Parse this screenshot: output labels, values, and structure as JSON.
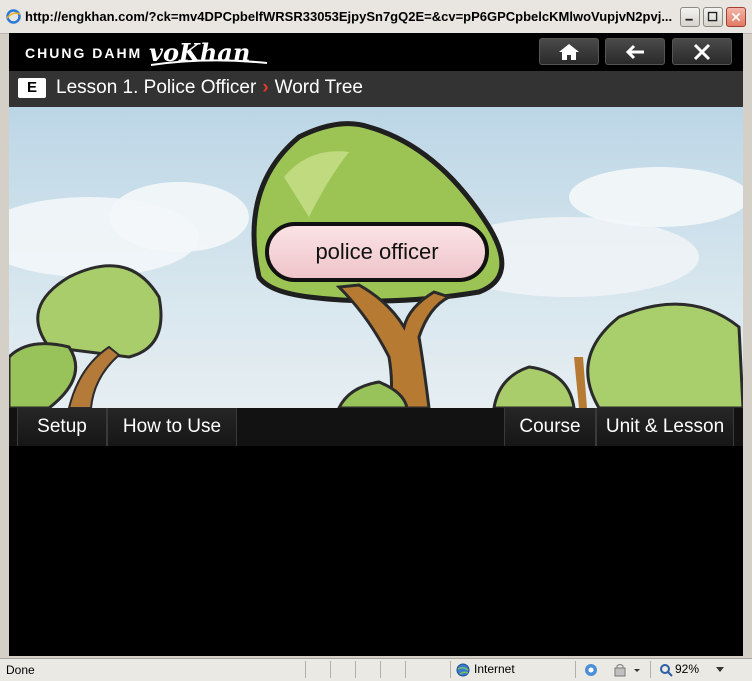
{
  "browser": {
    "title": "http://engkhan.com/?ck=mv4DPCpbelfWRSR33053EjpySn7gQ2E=&cv=pP6GPCpbelcKMlwoVupjvN2pvj...",
    "status": "Done",
    "zone": "Internet",
    "zoom": "92%"
  },
  "app": {
    "brand": "CHUNG DAHM",
    "logo_text": "voKhan",
    "header_icons": [
      "home-icon",
      "back-arrow-icon",
      "close-icon"
    ]
  },
  "breadcrumb": {
    "badge": "E",
    "lesson": "Lesson 1. Police Officer",
    "separator": "›",
    "page": "Word Tree"
  },
  "scene": {
    "word": "police officer"
  },
  "menu": {
    "setup": "Setup",
    "how_to_use": "How to Use",
    "course": "Course",
    "unit_lesson": "Unit & Lesson"
  },
  "colors": {
    "accent_separator": "#e03a2a",
    "pill_fill": "#f3d2d6",
    "tree_green": "#9cc455",
    "trunk_brown": "#b77a33"
  }
}
